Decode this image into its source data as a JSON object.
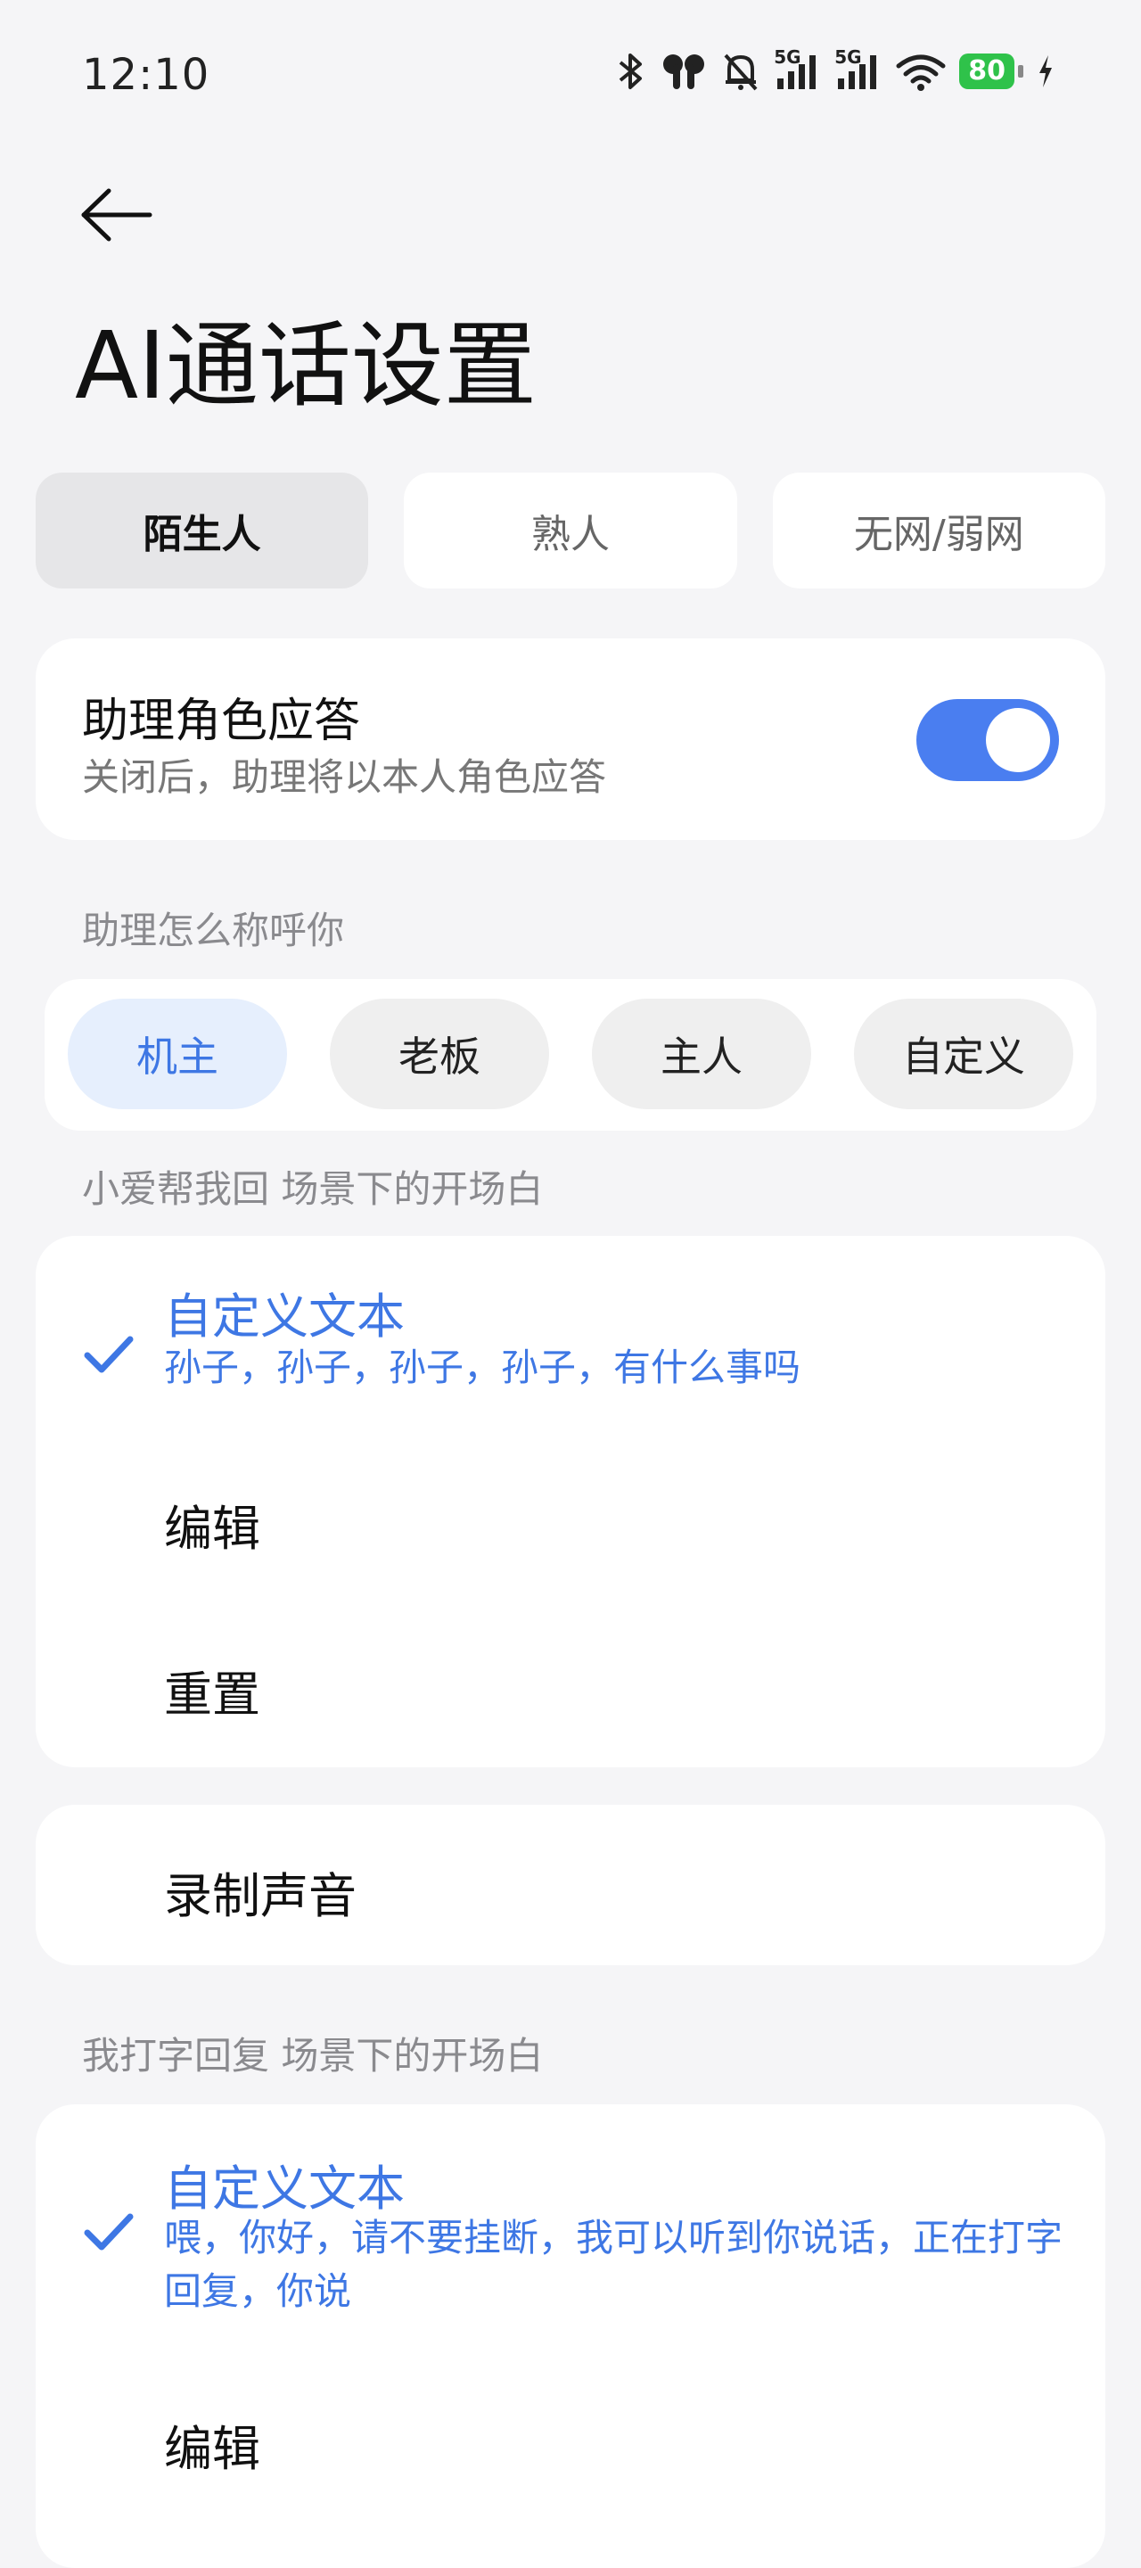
{
  "status_bar": {
    "time": "12:10",
    "sim1_tag": "5G",
    "sim2_tag": "5G",
    "battery": "80",
    "icons": [
      "bluetooth-icon",
      "earbuds-icon",
      "mute-bell-icon",
      "signal-icon",
      "signal-icon",
      "wifi-icon",
      "battery-icon",
      "charging-icon"
    ],
    "battery_color": "#2fc24a"
  },
  "header": {
    "title": "AI通话设置"
  },
  "tabs": [
    {
      "label": "陌生人",
      "active": true
    },
    {
      "label": "熟人",
      "active": false
    },
    {
      "label": "无网/弱网",
      "active": false
    }
  ],
  "assistant_role": {
    "title": "助理角色应答",
    "subtitle": "关闭后，助理将以本人角色应答",
    "enabled": true,
    "accent": "#4a7ef0"
  },
  "address": {
    "label": "助理怎么称呼你",
    "options": [
      "机主",
      "老板",
      "主人",
      "自定义"
    ],
    "selected": "机主"
  },
  "xiaoai_greeting": {
    "label": "小爱帮我回 场景下的开场白",
    "selected_title": "自定义文本",
    "selected_text": "孙子，孙子，孙子，孙子，有什么事吗",
    "edit_label": "编辑",
    "reset_label": "重置",
    "record_label": "录制声音"
  },
  "typing_greeting": {
    "label": "我打字回复 场景下的开场白",
    "selected_title": "自定义文本",
    "selected_text": "喂，你好，请不要挂断，我可以听到你说话，正在打字回复，你说",
    "edit_label": "编辑"
  }
}
